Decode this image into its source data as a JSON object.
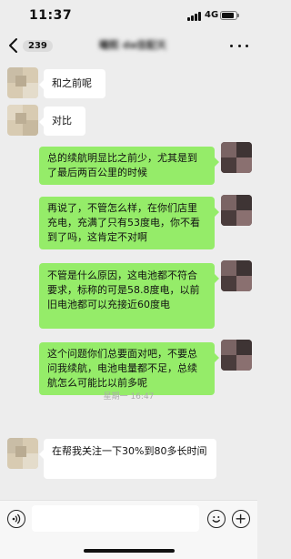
{
  "status_bar": {
    "time": "11:37",
    "network": "4G",
    "battery_level": 0.85
  },
  "nav": {
    "unread_count": "239",
    "chat_title": "曦熙 da佳配天"
  },
  "timestamp": "星期一 16:47",
  "messages": [
    {
      "side": "left",
      "text": "和之前呢"
    },
    {
      "side": "left",
      "text": "对比"
    },
    {
      "side": "right",
      "text": "总的续航明显比之前少，尤其是到了最后两百公里的时候"
    },
    {
      "side": "right",
      "text": "再说了，不管怎么样，在你们店里充电，充满了只有53度电，你不看到了吗，这肯定不对啊"
    },
    {
      "side": "right",
      "text": "不管是什么原因，这电池都不符合要求，标称的可是58.8度电，以前旧电池都可以充接近60度电"
    },
    {
      "side": "right",
      "text": "这个问题你们总要面对吧，不要总问我续航，电池电量都不足，总续航怎么可能比以前多呢"
    },
    {
      "side": "left",
      "text": "在帮我关注一下30%到80多长时间"
    }
  ],
  "input": {
    "value": "",
    "placeholder": ""
  },
  "icons": {
    "back": "chevron-left-icon",
    "more": "more-dots-icon",
    "voice": "voice-icon",
    "emoji": "emoji-icon",
    "add": "plus-icon"
  },
  "colors": {
    "background": "#ededed",
    "sent_bubble": "#95ec69",
    "received_bubble": "#ffffff"
  }
}
